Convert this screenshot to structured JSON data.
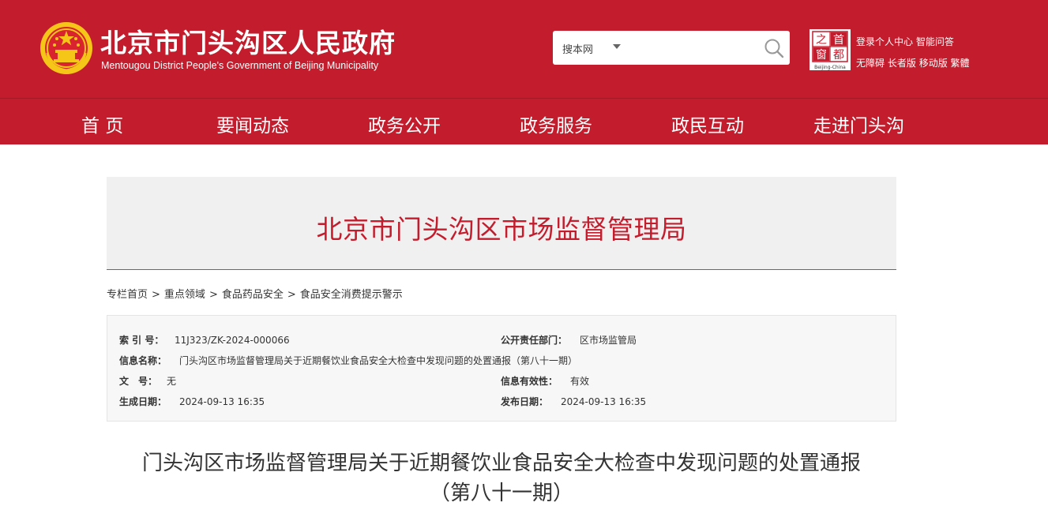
{
  "header": {
    "title": "北京市门头沟区人民政府",
    "subtitle": "Mentougou District People's Government of Beijing Municipality",
    "search_scope": "搜本网",
    "search_placeholder": "",
    "logo_chars": [
      "之",
      "首",
      "窗",
      "都"
    ],
    "logo_caption": "Beijing-China",
    "links_row1": [
      "登录",
      "个人中心",
      "智能问答"
    ],
    "links_row2": [
      "无障碍",
      "长者版",
      "移动版",
      "繁體"
    ]
  },
  "nav": {
    "items": [
      "首 页",
      "要闻动态",
      "政务公开",
      "政务服务",
      "政民互动",
      "走进门头沟"
    ]
  },
  "banner": {
    "title": "北京市门头沟区市场监督管理局"
  },
  "breadcrumb": [
    "专栏首页",
    "重点领域",
    "食品药品安全",
    "食品安全消费提示警示"
  ],
  "breadcrumb_separator": ">",
  "info": {
    "index_label": "索 引 号：",
    "index_value": "11J323/ZK-2024-000066",
    "dept_label": "公开责任部门：",
    "dept_value": "区市场监管局",
    "name_label": "信息名称：",
    "name_value": "门头沟区市场监督管理局关于近期餐饮业食品安全大检查中发现问题的处置通报（第八十一期）",
    "doc_label": "文　号：",
    "doc_value": "无",
    "valid_label": "信息有效性：",
    "valid_value": "有效",
    "created_label": "生成日期：",
    "created_value": "2024-09-13 16:35",
    "published_label": "发布日期：",
    "published_value": "2024-09-13 16:35"
  },
  "article": {
    "title_line1": "门头沟区市场监督管理局关于近期餐饮业食品安全大检查中发现问题的处置通报",
    "title_line2": "（第八十一期）"
  },
  "colors": {
    "brand_red": "#c31d2d",
    "banner_bg": "#f0f0f0",
    "gold": "#f5c518"
  }
}
